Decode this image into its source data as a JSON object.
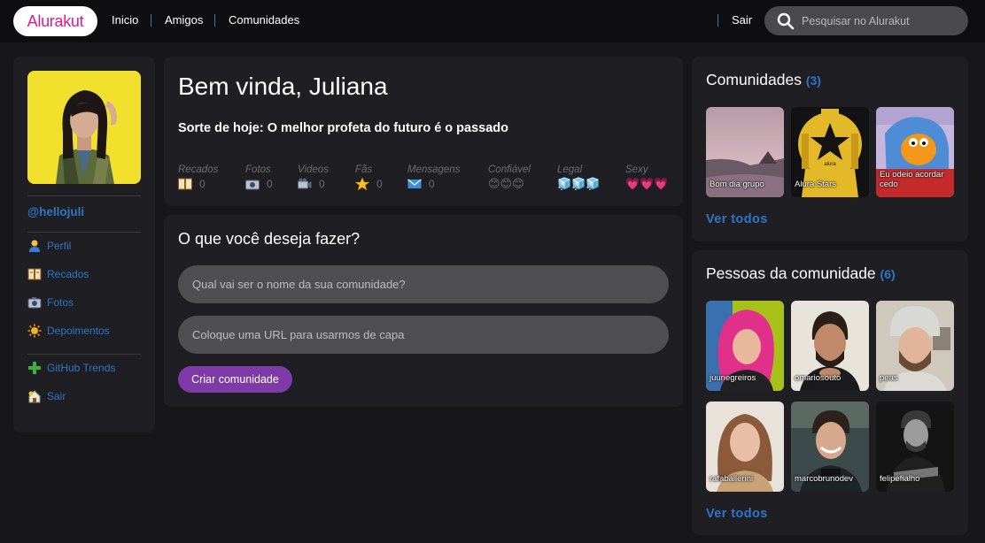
{
  "header": {
    "logo": "Alurakut",
    "nav": [
      "Inicio",
      "Amigos",
      "Comunidades"
    ],
    "logout": "Sair",
    "search_placeholder": "Pesquisar no Alurakut"
  },
  "profile": {
    "username": "@hellojuli",
    "menu": [
      {
        "label": "Perfil",
        "icon": "user-icon"
      },
      {
        "label": "Recados",
        "icon": "book-icon"
      },
      {
        "label": "Fotos",
        "icon": "camera-icon"
      },
      {
        "label": "Depoimentos",
        "icon": "sun-icon"
      }
    ],
    "menu2": [
      {
        "label": "GitHub Trends",
        "icon": "plus-icon"
      },
      {
        "label": "Sair",
        "icon": "logout-icon"
      }
    ]
  },
  "welcome": {
    "title": "Bem vinda, Juliana",
    "fortune": "Sorte de hoje: O melhor profeta do futuro é o passado",
    "stats": [
      {
        "label": "Recados",
        "value": "0",
        "icon": "book-icon"
      },
      {
        "label": "Fotos",
        "value": "0",
        "icon": "camera-icon"
      },
      {
        "label": "Videos",
        "value": "0",
        "icon": "video-camera-icon"
      },
      {
        "label": "Fãs",
        "value": "0",
        "icon": "star-icon"
      },
      {
        "label": "Mensagens",
        "value": "0",
        "icon": "envelope-icon"
      },
      {
        "label": "Confiável",
        "value": "😊😊😊",
        "icon": "smiley-icon"
      },
      {
        "label": "Legal",
        "value": "🧊🧊🧊",
        "icon": "ice-cube-icon"
      },
      {
        "label": "Sexy",
        "value": "💗💗💗",
        "icon": "heart-icon"
      }
    ]
  },
  "create": {
    "title": "O que você deseja fazer?",
    "name_placeholder": "Qual vai ser o nome da sua comunidade?",
    "url_placeholder": "Coloque uma URL para usarmos de capa",
    "button": "Criar comunidade"
  },
  "communities": {
    "title": "Comunidades",
    "count": "(3)",
    "items": [
      "Bom dia grupo",
      "Alura Stars",
      "Eu odeio acordar cedo"
    ],
    "see_all": "Ver todos"
  },
  "people": {
    "title": "Pessoas da comunidade",
    "count": "(6)",
    "items": [
      "juunegreiros",
      "omariosouto",
      "peas",
      "rafaballerini",
      "marcobrunodev",
      "felipefialho"
    ],
    "see_all": "Ver todos"
  },
  "colors": {
    "accent": "#2e75c8",
    "brand": "#d81d99",
    "button": "#7e3aa6"
  }
}
